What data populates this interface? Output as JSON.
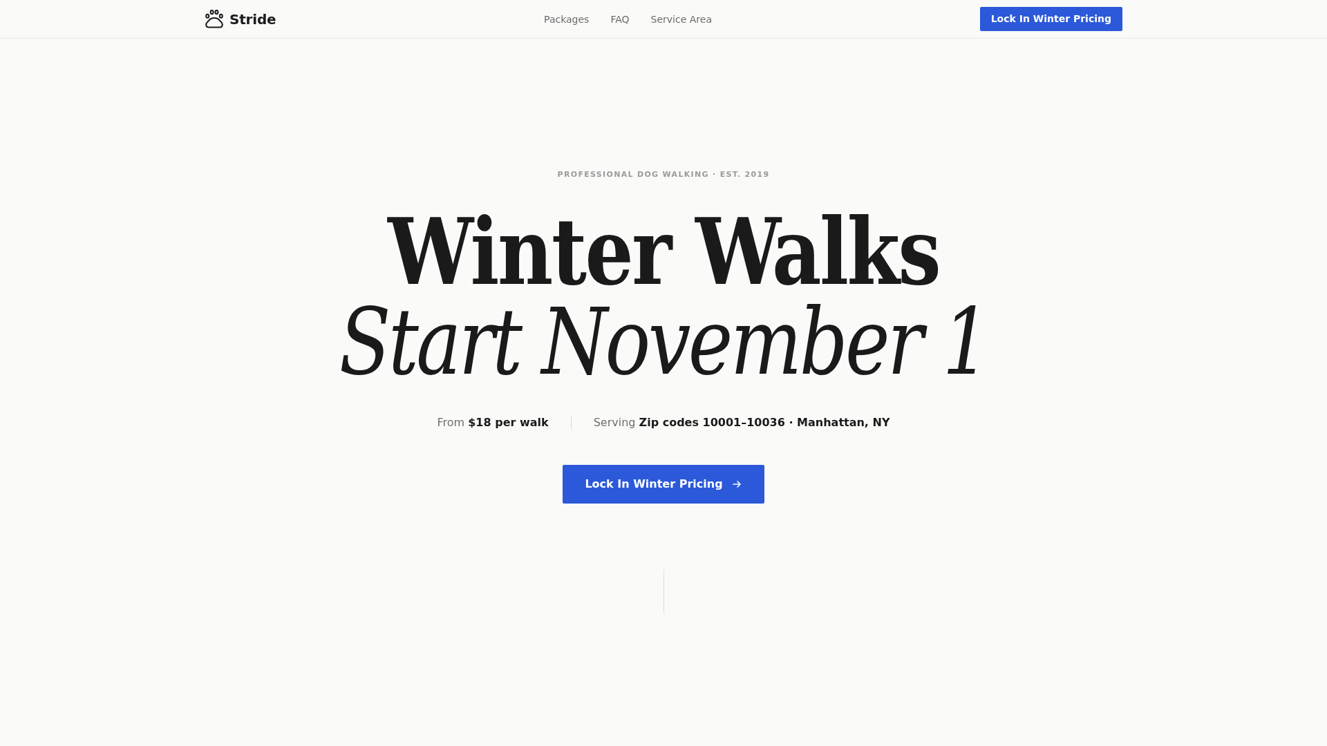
{
  "nav": {
    "brand": "Stride",
    "links": [
      "Packages",
      "FAQ",
      "Service Area"
    ],
    "cta": "Lock In Winter Pricing"
  },
  "hero": {
    "eyebrow": "PROFESSIONAL DOG WALKING · EST. 2019",
    "headline": [
      {
        "kind": "bold",
        "text": "Winter Walks"
      },
      {
        "kind": "italic",
        "text": "Start November 1"
      }
    ],
    "facts": [
      "From **$18 per walk**",
      "Serving **Zip codes 10001–10036 · Manhattan, NY**"
    ],
    "cta": "Lock In Winter Pricing"
  }
}
